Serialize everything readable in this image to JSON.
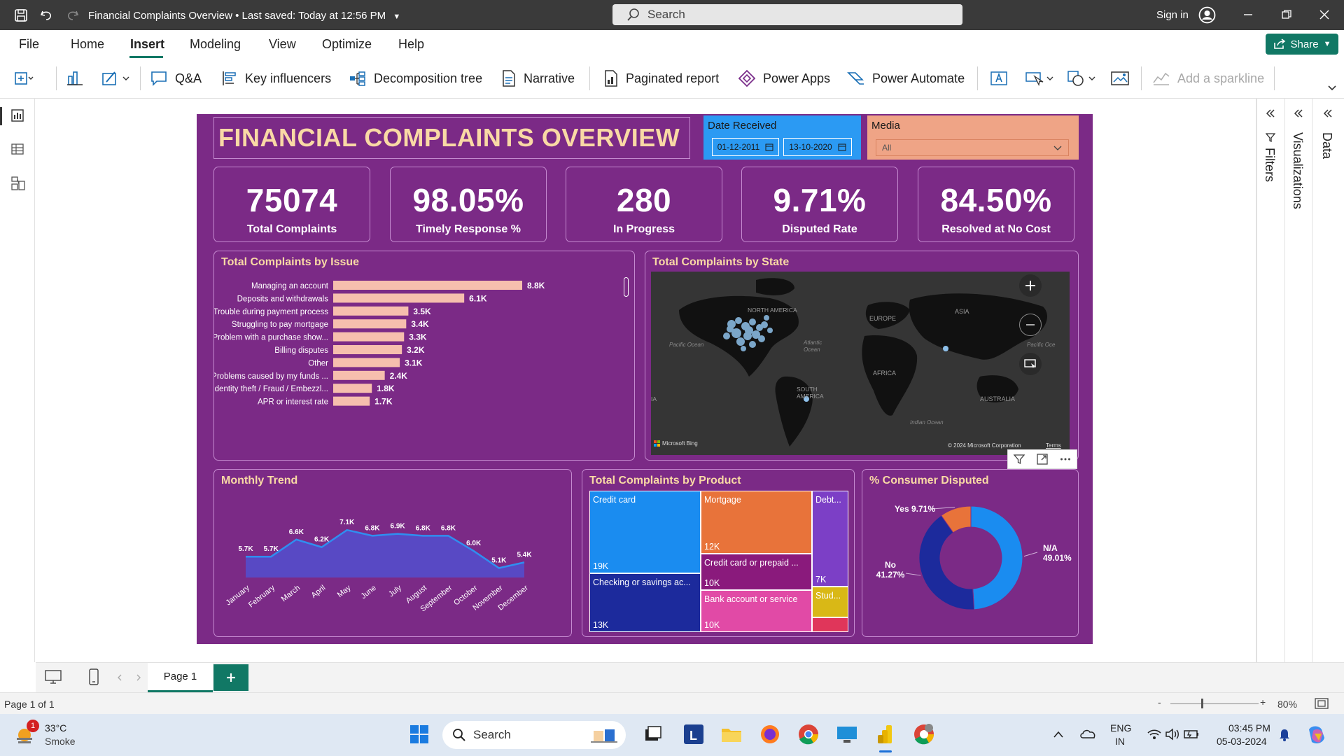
{
  "titlebar": {
    "doc_title": "Financial Complaints Overview • Last saved: Today at 12:56 PM",
    "search_placeholder": "Search",
    "signin": "Sign in"
  },
  "menu": {
    "items": [
      "File",
      "Home",
      "Insert",
      "Modeling",
      "View",
      "Optimize",
      "Help"
    ],
    "active": "Insert",
    "share": "Share"
  },
  "ribbon": {
    "qa": "Q&A",
    "key_influencers": "Key influencers",
    "decomposition_tree": "Decomposition tree",
    "narrative": "Narrative",
    "paginated_report": "Paginated report",
    "power_apps": "Power Apps",
    "power_automate": "Power Automate",
    "add_sparkline": "Add a sparkline"
  },
  "panes": {
    "filters": "Filters",
    "visualizations": "Visualizations",
    "data": "Data"
  },
  "report": {
    "title": "FINANCIAL COMPLAINTS OVERVIEW",
    "date_slicer": {
      "label": "Date Received",
      "start": "01-12-2011",
      "end": "13-10-2020"
    },
    "media_slicer": {
      "label": "Media",
      "value": "All"
    },
    "kpis": [
      {
        "value": "75074",
        "label": "Total Complaints"
      },
      {
        "value": "98.05%",
        "label": "Timely Response %"
      },
      {
        "value": "280",
        "label": "In Progress"
      },
      {
        "value": "9.71%",
        "label": "Disputed Rate"
      },
      {
        "value": "84.50%",
        "label": "Resolved at No Cost"
      }
    ],
    "colors": {
      "background": "#7b2a86",
      "title_text": "#f9d9a5",
      "bar": "#f6bfae",
      "line": "#2f8ef0",
      "area": "#5849c4"
    }
  },
  "chart_data": [
    {
      "type": "bar",
      "title": "Total Complaints by Issue",
      "categories": [
        "Managing an account",
        "Deposits and withdrawals",
        "Trouble during payment process",
        "Struggling to pay mortgage",
        "Problem with a purchase show...",
        "Billing disputes",
        "Other",
        "Problems caused by my funds ...",
        "Identity theft / Fraud / Embezzl...",
        "APR or interest rate"
      ],
      "values": [
        8800,
        6100,
        3500,
        3400,
        3300,
        3200,
        3100,
        2400,
        1800,
        1700
      ],
      "labels": [
        "8.8K",
        "6.1K",
        "3.5K",
        "3.4K",
        "3.3K",
        "3.2K",
        "3.1K",
        "2.4K",
        "1.8K",
        "1.7K"
      ],
      "orientation": "horizontal"
    },
    {
      "type": "area",
      "title": "Monthly Trend",
      "categories": [
        "January",
        "February",
        "March",
        "April",
        "May",
        "June",
        "July",
        "August",
        "September",
        "October",
        "November",
        "December"
      ],
      "values": [
        5700,
        5700,
        6600,
        6200,
        7100,
        6800,
        6900,
        6800,
        6800,
        6000,
        5100,
        5400
      ],
      "labels": [
        "5.7K",
        "5.7K",
        "6.6K",
        "6.2K",
        "7.1K",
        "6.8K",
        "6.9K",
        "6.8K",
        "6.8K",
        "6.0K",
        "5.1K",
        "5.4K"
      ]
    },
    {
      "type": "treemap",
      "title": "Total Complaints by Product",
      "items": [
        {
          "name": "Credit card",
          "label": "19K",
          "value": 19000,
          "color": "#1a8cf0"
        },
        {
          "name": "Checking or savings ac...",
          "label": "13K",
          "value": 13000,
          "color": "#1c2a9c"
        },
        {
          "name": "Mortgage",
          "label": "12K",
          "value": 12000,
          "color": "#e8733a"
        },
        {
          "name": "Credit card or prepaid ...",
          "label": "10K",
          "value": 10000,
          "color": "#8a1a7c"
        },
        {
          "name": "Bank account or service",
          "label": "10K",
          "value": 10000,
          "color": "#e14aa6"
        },
        {
          "name": "Debt...",
          "label": "7K",
          "value": 7000,
          "color": "#7c3fc6"
        },
        {
          "name": "Stud...",
          "label": "",
          "value": 3000,
          "color": "#d9b816"
        },
        {
          "name": "",
          "label": "",
          "value": 1500,
          "color": "#e0365a"
        }
      ]
    },
    {
      "type": "pie",
      "title": "% Consumer Disputed",
      "donut": true,
      "slices": [
        {
          "name": "N/A",
          "label": "N/A 49.01%",
          "value": 49.01,
          "color": "#1a8cf0"
        },
        {
          "name": "No",
          "label": "No 41.27%",
          "value": 41.27,
          "color": "#1c2a9c"
        },
        {
          "name": "Yes",
          "label": "Yes 9.71%",
          "value": 9.71,
          "color": "#e8733a"
        }
      ]
    }
  ],
  "map": {
    "title": "Total Complaints by State",
    "labels": [
      "NORTH AMERICA",
      "EUROPE",
      "ASIA",
      "AFRICA",
      "SOUTH AMERICA",
      "AUSTRALIA",
      "Pacific Ocean",
      "Atlantic Ocean",
      "Indian Ocean",
      "Pacific Oce",
      "IA"
    ],
    "attribution": "Microsoft Bing",
    "copyright": "© 2024 Microsoft Corporation",
    "terms": "Terms"
  },
  "pages": {
    "tab": "Page 1",
    "status": "Page 1 of 1",
    "zoom": "80%"
  },
  "taskbar": {
    "weather_temp": "33°C",
    "weather_desc": "Smoke",
    "weather_badge": "1",
    "search": "Search",
    "lang_1": "ENG",
    "lang_2": "IN",
    "time": "03:45 PM",
    "date": "05-03-2024"
  }
}
